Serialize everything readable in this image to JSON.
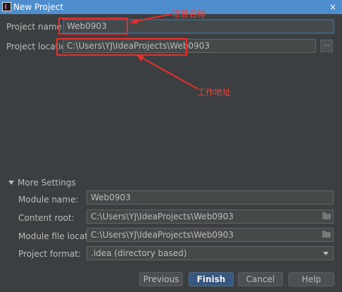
{
  "window": {
    "title": "New Project",
    "close_glyph": "×"
  },
  "top": {
    "project_name_label": "Project name:",
    "project_name_value": "Web0903",
    "project_location_label": "Project location:",
    "project_location_value": "C:\\Users\\YJ\\IdeaProjects\\Web0903",
    "browse_label": "..."
  },
  "annotations": {
    "name": "项目名称",
    "location": "工作地址",
    "color": "#ff3b30"
  },
  "more_settings": {
    "title": "More Settings",
    "module_name_label": "Module name:",
    "module_name_value": "Web0903",
    "content_root_label": "Content root:",
    "content_root_value": "C:\\Users\\YJ\\IdeaProjects\\Web0903",
    "module_file_location_label": "Module file location:",
    "module_file_location_value": "C:\\Users\\YJ\\IdeaProjects\\Web0903",
    "project_format_label": "Project format:",
    "project_format_value": ".idea (directory based)"
  },
  "buttons": {
    "previous": "Previous",
    "finish": "Finish",
    "cancel": "Cancel",
    "help": "Help"
  },
  "colors": {
    "background": "#3c3f41",
    "titlebar": "#4f8ece",
    "primary_button": "#365880",
    "focus_border": "#3d6185"
  }
}
